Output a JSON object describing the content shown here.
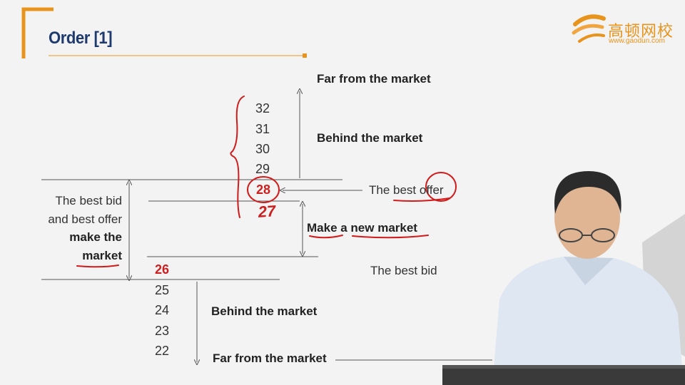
{
  "slide": {
    "title": "Order [1]"
  },
  "logo": {
    "name_cn": "高顿网校",
    "url": "www.gaodun.com"
  },
  "prices_upper": [
    "32",
    "31",
    "30",
    "29"
  ],
  "best_offer_price": "28",
  "handwritten_price": "27",
  "best_bid_price": "26",
  "prices_lower": [
    "25",
    "24",
    "23",
    "22"
  ],
  "labels": {
    "far_top": "Far from the market",
    "behind_top": "Behind the market",
    "best_offer": "The best offer",
    "new_market": "Make a new market",
    "best_bid": "The best bid",
    "behind_bottom": "Behind the market",
    "far_bottom": "Far from the market"
  },
  "side_note": {
    "line1": "The best bid",
    "line2": "and best offer",
    "line3": "make the",
    "line4": "market"
  },
  "colors": {
    "title": "#1e3a6e",
    "accent": "#e8941c",
    "annotation": "#d11a1a"
  }
}
